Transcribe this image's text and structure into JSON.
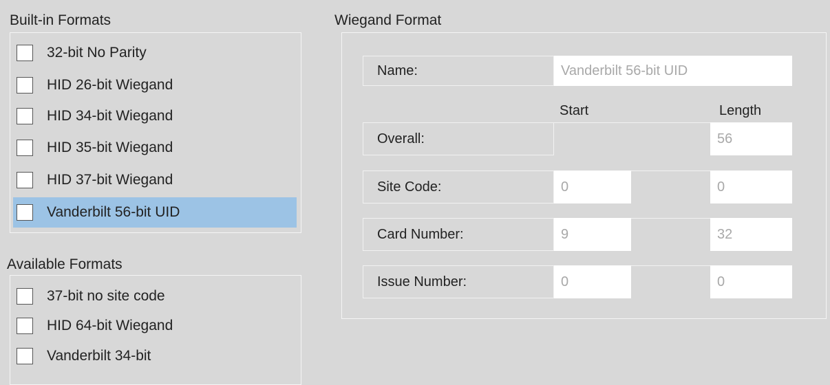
{
  "builtin": {
    "title": "Built-in Formats",
    "items": [
      {
        "label": "32-bit No Parity",
        "selected": false
      },
      {
        "label": "HID 26-bit Wiegand",
        "selected": false
      },
      {
        "label": "HID 34-bit Wiegand",
        "selected": false
      },
      {
        "label": "HID 35-bit Wiegand",
        "selected": false
      },
      {
        "label": "HID 37-bit Wiegand",
        "selected": false
      },
      {
        "label": "Vanderbilt 56-bit UID",
        "selected": true
      }
    ]
  },
  "available": {
    "title": "Available Formats",
    "items": [
      {
        "label": "37-bit no site code"
      },
      {
        "label": "HID 64-bit Wiegand"
      },
      {
        "label": "Vanderbilt 34-bit"
      }
    ]
  },
  "wiegand": {
    "title": "Wiegand Format",
    "name_label": "Name:",
    "name_value": "Vanderbilt 56-bit UID",
    "start_header": "Start",
    "length_header": "Length",
    "overall_label": "Overall:",
    "overall_length": "56",
    "site_label": "Site Code:",
    "site_start": "0",
    "site_length": "0",
    "card_label": "Card Number:",
    "card_start": "9",
    "card_length": "32",
    "issue_label": "Issue Number:",
    "issue_start": "0",
    "issue_length": "0"
  },
  "colors": {
    "background": "#d8d8d8",
    "selection": "#9cc3e5",
    "input_text": "#a8a8a8"
  }
}
